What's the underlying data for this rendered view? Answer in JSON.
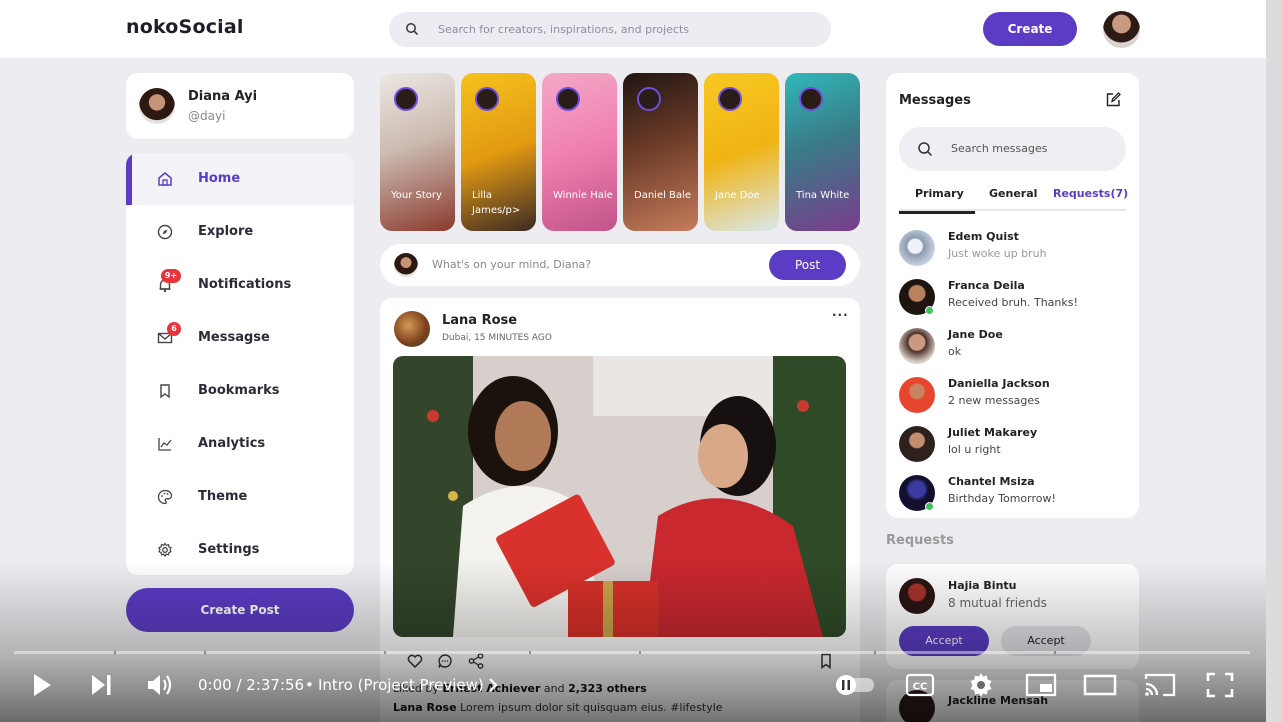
{
  "app": {
    "logo": "nokoSocial"
  },
  "nav": {
    "search_placeholder": "Search for creators, inspirations, and projects",
    "create_label": "Create"
  },
  "profile": {
    "name": "Diana Ayi",
    "handle": "@dayi"
  },
  "sidebar": {
    "items": [
      {
        "label": "Home",
        "icon": "home-icon",
        "active": true
      },
      {
        "label": "Explore",
        "icon": "compass-icon"
      },
      {
        "label": "Notifications",
        "icon": "bell-icon",
        "badge": "9+"
      },
      {
        "label": "Messagse",
        "icon": "mail-icon",
        "badge": "6"
      },
      {
        "label": "Bookmarks",
        "icon": "bookmark-icon"
      },
      {
        "label": "Analytics",
        "icon": "chart-icon"
      },
      {
        "label": "Theme",
        "icon": "palette-icon"
      },
      {
        "label": "Settings",
        "icon": "gear-icon"
      }
    ],
    "create_post_label": "Create Post"
  },
  "stories": [
    {
      "name": "Your Story",
      "color": "#e7e3df"
    },
    {
      "name": "Lilla James/p>",
      "color": "#f0b418"
    },
    {
      "name": "Winnie Hale",
      "color": "#f3a2c4"
    },
    {
      "name": "Daniel Bale",
      "color": "#2c1e1a"
    },
    {
      "name": "Jane Doe",
      "color": "#f7c020"
    },
    {
      "name": "Tina White",
      "color": "#36a6a8"
    }
  ],
  "compose": {
    "placeholder": "What's on your mind, Diana?",
    "post_label": "Post"
  },
  "feed": {
    "user": "Lana Rose",
    "location": "Dubai, 15 MINUTES AGO",
    "more": "···",
    "liked_by_prefix": "Liked by ",
    "liked_by_user": "Ernest Achiever",
    "liked_by_mid": " and ",
    "liked_by_count": "2,323 others",
    "caption_user": "Lana Rose",
    "caption_text": " Lorem ipsum dolor sit quisquam eius. #lifestyle"
  },
  "messages": {
    "title": "Messages",
    "search_placeholder": "Search messages",
    "tabs": [
      "Primary",
      "General",
      "Requests(7)"
    ],
    "items": [
      {
        "name": "Edem Quist",
        "text": "Just woke up bruh",
        "light": true,
        "color": "#9aa6b8",
        "online": false
      },
      {
        "name": "Franca Deila",
        "text": "Received bruh. Thanks!",
        "light": false,
        "color": "#3a2a22",
        "online": true
      },
      {
        "name": "Jane Doe",
        "text": "ok",
        "light": false,
        "color": "#8a6656",
        "online": false
      },
      {
        "name": "Daniella Jackson",
        "text": "2 new messages",
        "light": false,
        "color": "#e8452e",
        "online": false
      },
      {
        "name": "Juliet Makarey",
        "text": "lol u right",
        "light": false,
        "color": "#2e211d",
        "online": false
      },
      {
        "name": "Chantel Msiza",
        "text": "Birthday Tomorrow!",
        "light": false,
        "color": "#1a1840",
        "online": true
      }
    ]
  },
  "requests": {
    "title": "Requests",
    "items": [
      {
        "name": "Hajia Bintu",
        "mutual": "8 mutual friends",
        "accept": "Accept",
        "decline": "Accept"
      },
      {
        "name": "Jackline Mensah"
      }
    ]
  },
  "player": {
    "time": "0:00 / 2:37:56",
    "separator": "•",
    "chapter": "Intro (Project Preview)",
    "progress": 0
  }
}
